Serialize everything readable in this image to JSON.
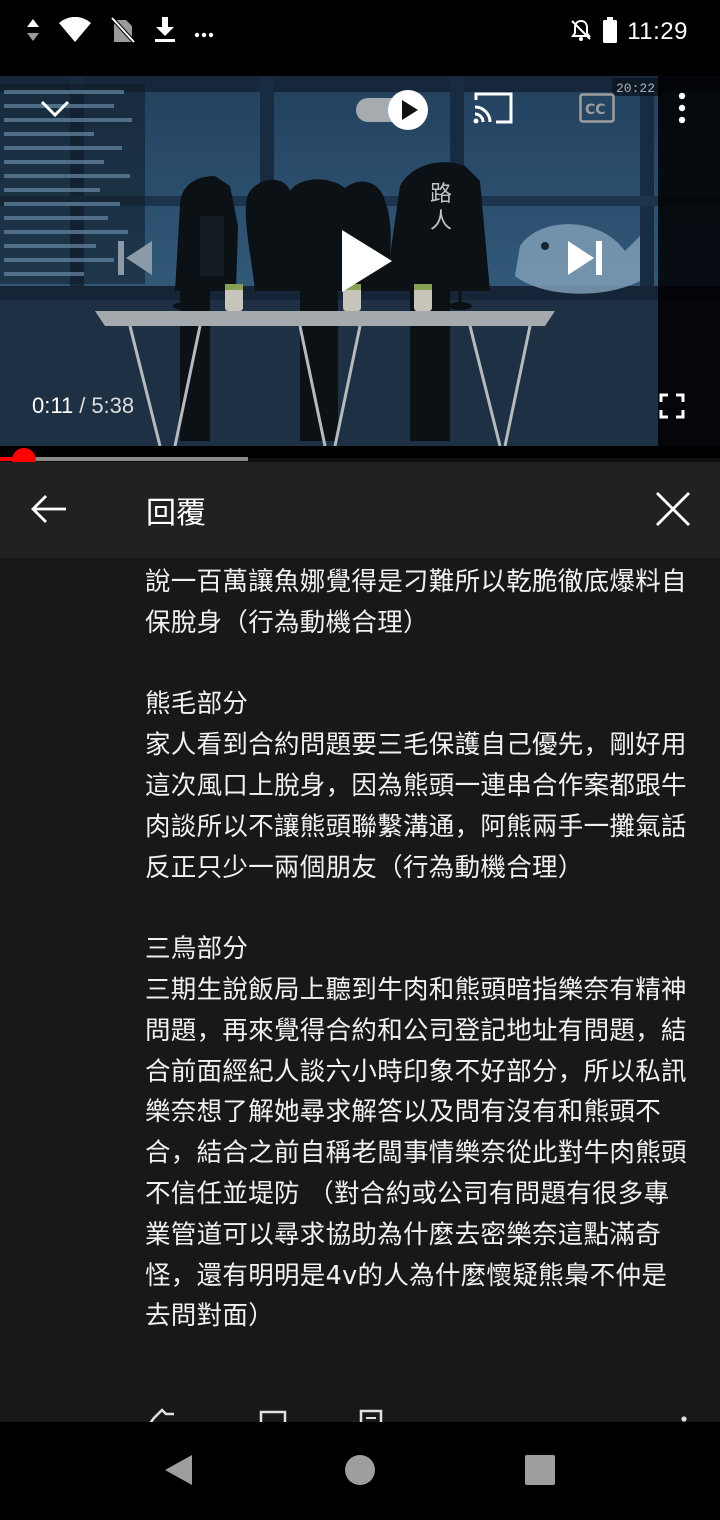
{
  "status_bar": {
    "time": "11:29",
    "left_icons": [
      "data-arrows-icon",
      "wifi-icon",
      "no-sim-icon",
      "download-icon",
      "more-notifications-icon"
    ],
    "right_icons": [
      "alarm-off-icon",
      "battery-icon"
    ]
  },
  "player": {
    "current_time": "0:11",
    "separator": "/",
    "duration": "5:38",
    "progress_fraction": 0.033,
    "buffered_fraction": 0.345,
    "overlay_clock": "20:22",
    "scene_sign_text": "路\n人",
    "controls": [
      "collapse-icon",
      "autoplay-toggle",
      "cast-icon",
      "captions-icon",
      "more-vert-icon",
      "previous-icon",
      "play-icon",
      "next-icon",
      "fullscreen-icon"
    ],
    "accent_color": "#ff0000"
  },
  "replies_header": {
    "title": "回覆"
  },
  "comment": {
    "text": "說一百萬讓魚娜覺得是刁難所以乾脆徹底爆料自保脫身（行為動機合理）\n\n熊毛部分\n家人看到合約問題要三毛保護自己優先，剛好用這次風口上脫身，因為熊頭一連串合作案都跟牛肉談所以不讓熊頭聯繫溝通，阿熊兩手一攤氣話反正只少一兩個朋友（行為動機合理）\n\n三鳥部分\n三期生說飯局上聽到牛肉和熊頭暗指樂奈有精神問題，再來覺得合約和公司登記地址有問題，結合前面經紀人談六小時印象不好部分，所以私訊樂奈想了解她尋求解答以及問有沒有和熊頭不合，結合之前自稱老闆事情樂奈從此對牛肉熊頭不信任並堤防 （對合約或公司有問題有很多專業管道可以尋求協助為什麼去密樂奈這點滿奇怪，還有明明是4v的人為什麼懷疑熊梟不仲是去問對面）",
    "actions": [
      "like-icon",
      "dislike-icon",
      "reply-icon",
      "more-vert-icon"
    ]
  },
  "nav_bar": {
    "buttons": [
      "back-triangle-icon",
      "home-circle-icon",
      "recents-square-icon"
    ]
  }
}
